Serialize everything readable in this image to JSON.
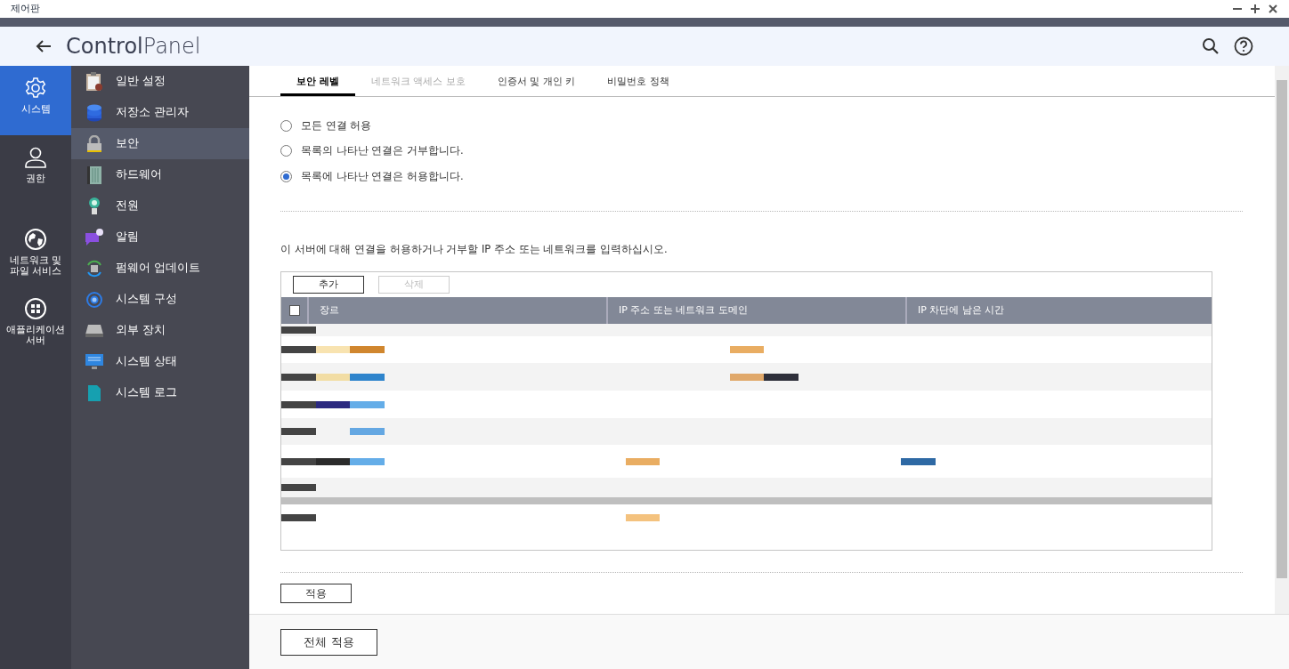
{
  "window": {
    "title": "제어판"
  },
  "header": {
    "title": "**Control**Panel"
  },
  "nav": [
    {
      "label": "시스템",
      "selected": true
    },
    {
      "label": "권한",
      "selected": false
    },
    {
      "label": "네트워크 및\n파일 서비스",
      "selected": false
    },
    {
      "label": "애플리케이션\n서버",
      "selected": false
    }
  ],
  "sidebar": {
    "items": [
      {
        "label": "일반 설정",
        "selected": false
      },
      {
        "label": "저장소 관리자",
        "selected": false
      },
      {
        "label": "보안",
        "selected": true
      },
      {
        "label": "하드웨어",
        "selected": false
      },
      {
        "label": "전원",
        "selected": false
      },
      {
        "label": "알림",
        "selected": false
      },
      {
        "label": "펌웨어 업데이트",
        "selected": false
      },
      {
        "label": "시스템 구성",
        "selected": false
      },
      {
        "label": "외부 장치",
        "selected": false
      },
      {
        "label": "시스템 상태",
        "selected": false
      },
      {
        "label": "시스템 로그",
        "selected": false
      }
    ]
  },
  "tabs": [
    {
      "label": "보안 레벨",
      "selected": true,
      "disabled": false
    },
    {
      "label": "네트워크 액세스 보호",
      "selected": false,
      "disabled": true
    },
    {
      "label": "인증서 및 개인 키",
      "selected": false,
      "disabled": false
    },
    {
      "label": "비밀번호 정책",
      "selected": false,
      "disabled": false
    }
  ],
  "options": [
    {
      "label": "모든 연결 허용",
      "selected": false
    },
    {
      "label": "목록의 나타난 연결은 거부합니다.",
      "selected": false
    },
    {
      "label": "목록에 나타난 연결은 허용합니다.",
      "selected": true
    }
  ],
  "instruction": "이 서버에 대해 연결을 허용하거나 거부할 IP 주소 또는 네트워크를 입력하십시오.",
  "toolbar": [
    {
      "label": "추가",
      "disabled": false
    },
    {
      "label": "삭제",
      "disabled": true
    }
  ],
  "table": {
    "select_all": {
      "checked": false
    },
    "columns": [
      "장르",
      "IP 주소 또는 네트워크 도메인",
      "IP 차단에 남은 시간"
    ],
    "rows": [
      {
        "kind": "redacted"
      },
      {
        "kind": "redacted"
      },
      {
        "kind": "redacted"
      },
      {
        "kind": "redacted"
      },
      {
        "kind": "redacted"
      },
      {
        "kind": "redacted"
      },
      {
        "kind": "redacted"
      },
      {
        "kind": "redacted"
      }
    ]
  },
  "apply_button": "적용",
  "footer": {
    "button": "전체 적용"
  }
}
